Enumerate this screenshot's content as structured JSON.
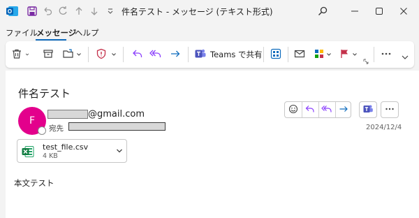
{
  "window": {
    "title": "件名テスト - メッセージ (テキスト形式)"
  },
  "menu": {
    "tabs": [
      {
        "label": "ファイル",
        "active": false
      },
      {
        "label": "メッセージ",
        "active": true
      },
      {
        "label": "ヘルプ",
        "active": false
      }
    ]
  },
  "ribbon": {
    "teams_label": "Teams で共有"
  },
  "message": {
    "subject": "件名テスト",
    "avatar_initial": "F",
    "sender_domain": "@gmail.com",
    "to_label": "宛先",
    "date": "2024/12/4",
    "body": "本文テスト"
  },
  "attachment": {
    "name": "test_file.csv",
    "size": "4 KB"
  },
  "colors": {
    "accent": "#0f6cbd",
    "reply_purple": "#8a3ffc",
    "avatar": "#e3008c",
    "teams": "#4b53bc",
    "excel": "#107c41",
    "flag": "#c4314b"
  },
  "icons": {
    "app": "outlook-icon",
    "save": "save-icon",
    "undo": "undo-icon",
    "redo": "redo-icon",
    "previous": "arrow-up-icon",
    "next": "arrow-down-icon",
    "search": "search-icon",
    "delete": "trash-icon",
    "archive": "archive-icon",
    "move": "move-to-folder-icon",
    "report": "shield-icon",
    "reply": "reply-icon",
    "reply_all": "reply-all-icon",
    "forward": "forward-icon",
    "teams": "teams-icon",
    "apps": "apps-icon",
    "read_unread": "envelope-icon",
    "categorize": "categorize-icon",
    "flag": "flag-icon",
    "more": "more-icon",
    "emoji": "emoji-icon",
    "attachment": "excel-icon"
  }
}
